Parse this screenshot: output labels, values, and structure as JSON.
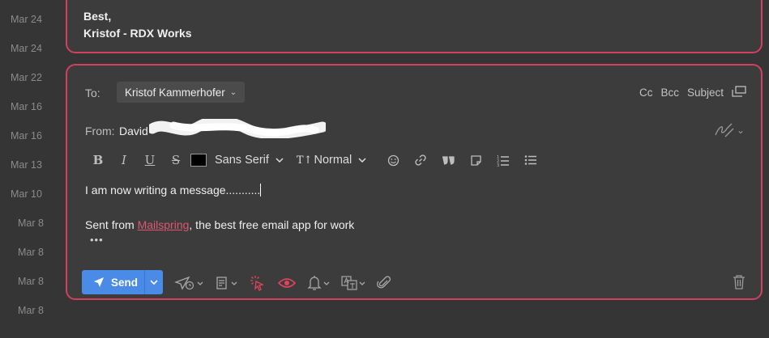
{
  "thread_dates": [
    "Mar 24",
    "Mar 24",
    "Mar 22",
    "Mar 16",
    "Mar 16",
    "Mar 13",
    "Mar 10",
    "Mar 8",
    "Mar 8",
    "Mar 8",
    "Mar 8"
  ],
  "previous_message": {
    "line1": "Best,",
    "line2": "Kristof - RDX Works"
  },
  "composer": {
    "to_label": "To:",
    "recipient": "Kristof Kammerhofer",
    "cc_label": "Cc",
    "bcc_label": "Bcc",
    "subject_label": "Subject",
    "from_label": "From:",
    "from_name": "David",
    "body_line": "I am now writing a message...........",
    "signature_prefix": "Sent from ",
    "signature_link": "Mailspring",
    "signature_suffix": ", the best free email app for work",
    "quoted_toggle": "•••"
  },
  "toolbar": {
    "bold": "B",
    "italic": "I",
    "underline": "U",
    "strike": "S",
    "font_family": "Sans Serif",
    "font_size_icon": "T↑",
    "font_size": "Normal",
    "text_color": "#000000"
  },
  "actions": {
    "send_label": "Send"
  },
  "colors": {
    "accent_border": "#d23f5f",
    "send_blue": "#4a8be8",
    "link": "#e0556f",
    "tracking_active": "#e0445d"
  },
  "icons": [
    "emoji-icon",
    "link-icon",
    "quote-icon",
    "template-icon",
    "numbered-list-icon",
    "bullet-list-icon",
    "send-later-icon",
    "templates-icon",
    "link-tracking-icon",
    "read-receipt-icon",
    "reminder-icon",
    "translate-icon",
    "attachment-icon",
    "trash-icon"
  ]
}
